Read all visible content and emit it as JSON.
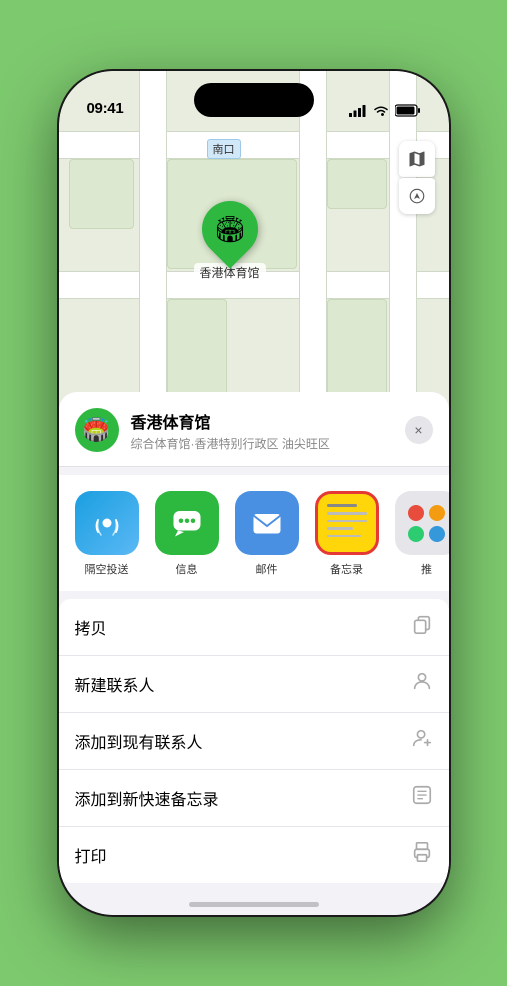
{
  "status": {
    "time": "09:41",
    "location_icon": "▶"
  },
  "map": {
    "label": "南口"
  },
  "venue": {
    "name": "香港体育馆",
    "description": "综合体育馆·香港特别行政区 油尖旺区",
    "icon": "🏟️"
  },
  "share_items": [
    {
      "id": "airdrop",
      "label": "隔空投送",
      "type": "airdrop"
    },
    {
      "id": "messages",
      "label": "信息",
      "type": "messages"
    },
    {
      "id": "mail",
      "label": "邮件",
      "type": "mail"
    },
    {
      "id": "notes",
      "label": "备忘录",
      "type": "notes"
    },
    {
      "id": "more",
      "label": "推",
      "type": "more"
    }
  ],
  "actions": [
    {
      "id": "copy",
      "label": "拷贝",
      "icon": "📋"
    },
    {
      "id": "new-contact",
      "label": "新建联系人",
      "icon": "👤"
    },
    {
      "id": "add-contact",
      "label": "添加到现有联系人",
      "icon": "👤"
    },
    {
      "id": "add-note",
      "label": "添加到新快速备忘录",
      "icon": "📝"
    },
    {
      "id": "print",
      "label": "打印",
      "icon": "🖨️"
    }
  ],
  "close_label": "×"
}
